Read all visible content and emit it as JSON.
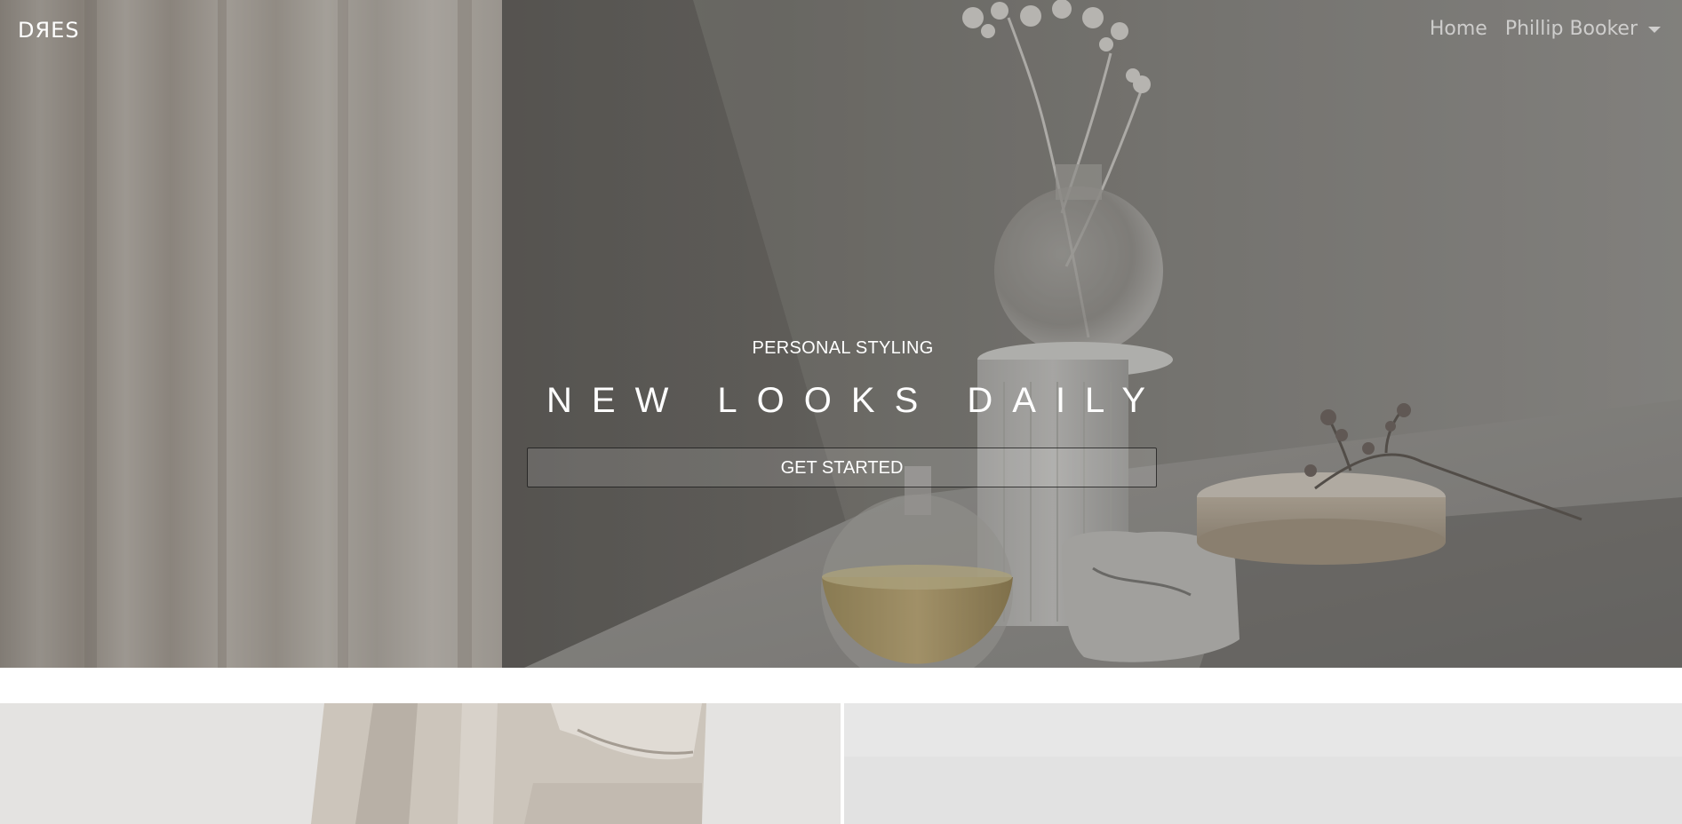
{
  "navbar": {
    "brand": "DЯES",
    "links": {
      "home": "Home",
      "user": "Phillip Booker"
    }
  },
  "hero": {
    "eyebrow": "PERSONAL STYLING",
    "headline": "NEW LOOKS DAILY",
    "cta_label": "GET STARTED"
  },
  "colors": {
    "hero_overlay": "#3a3836",
    "page_background": "#ffffff",
    "text_on_hero": "#ffffff"
  }
}
